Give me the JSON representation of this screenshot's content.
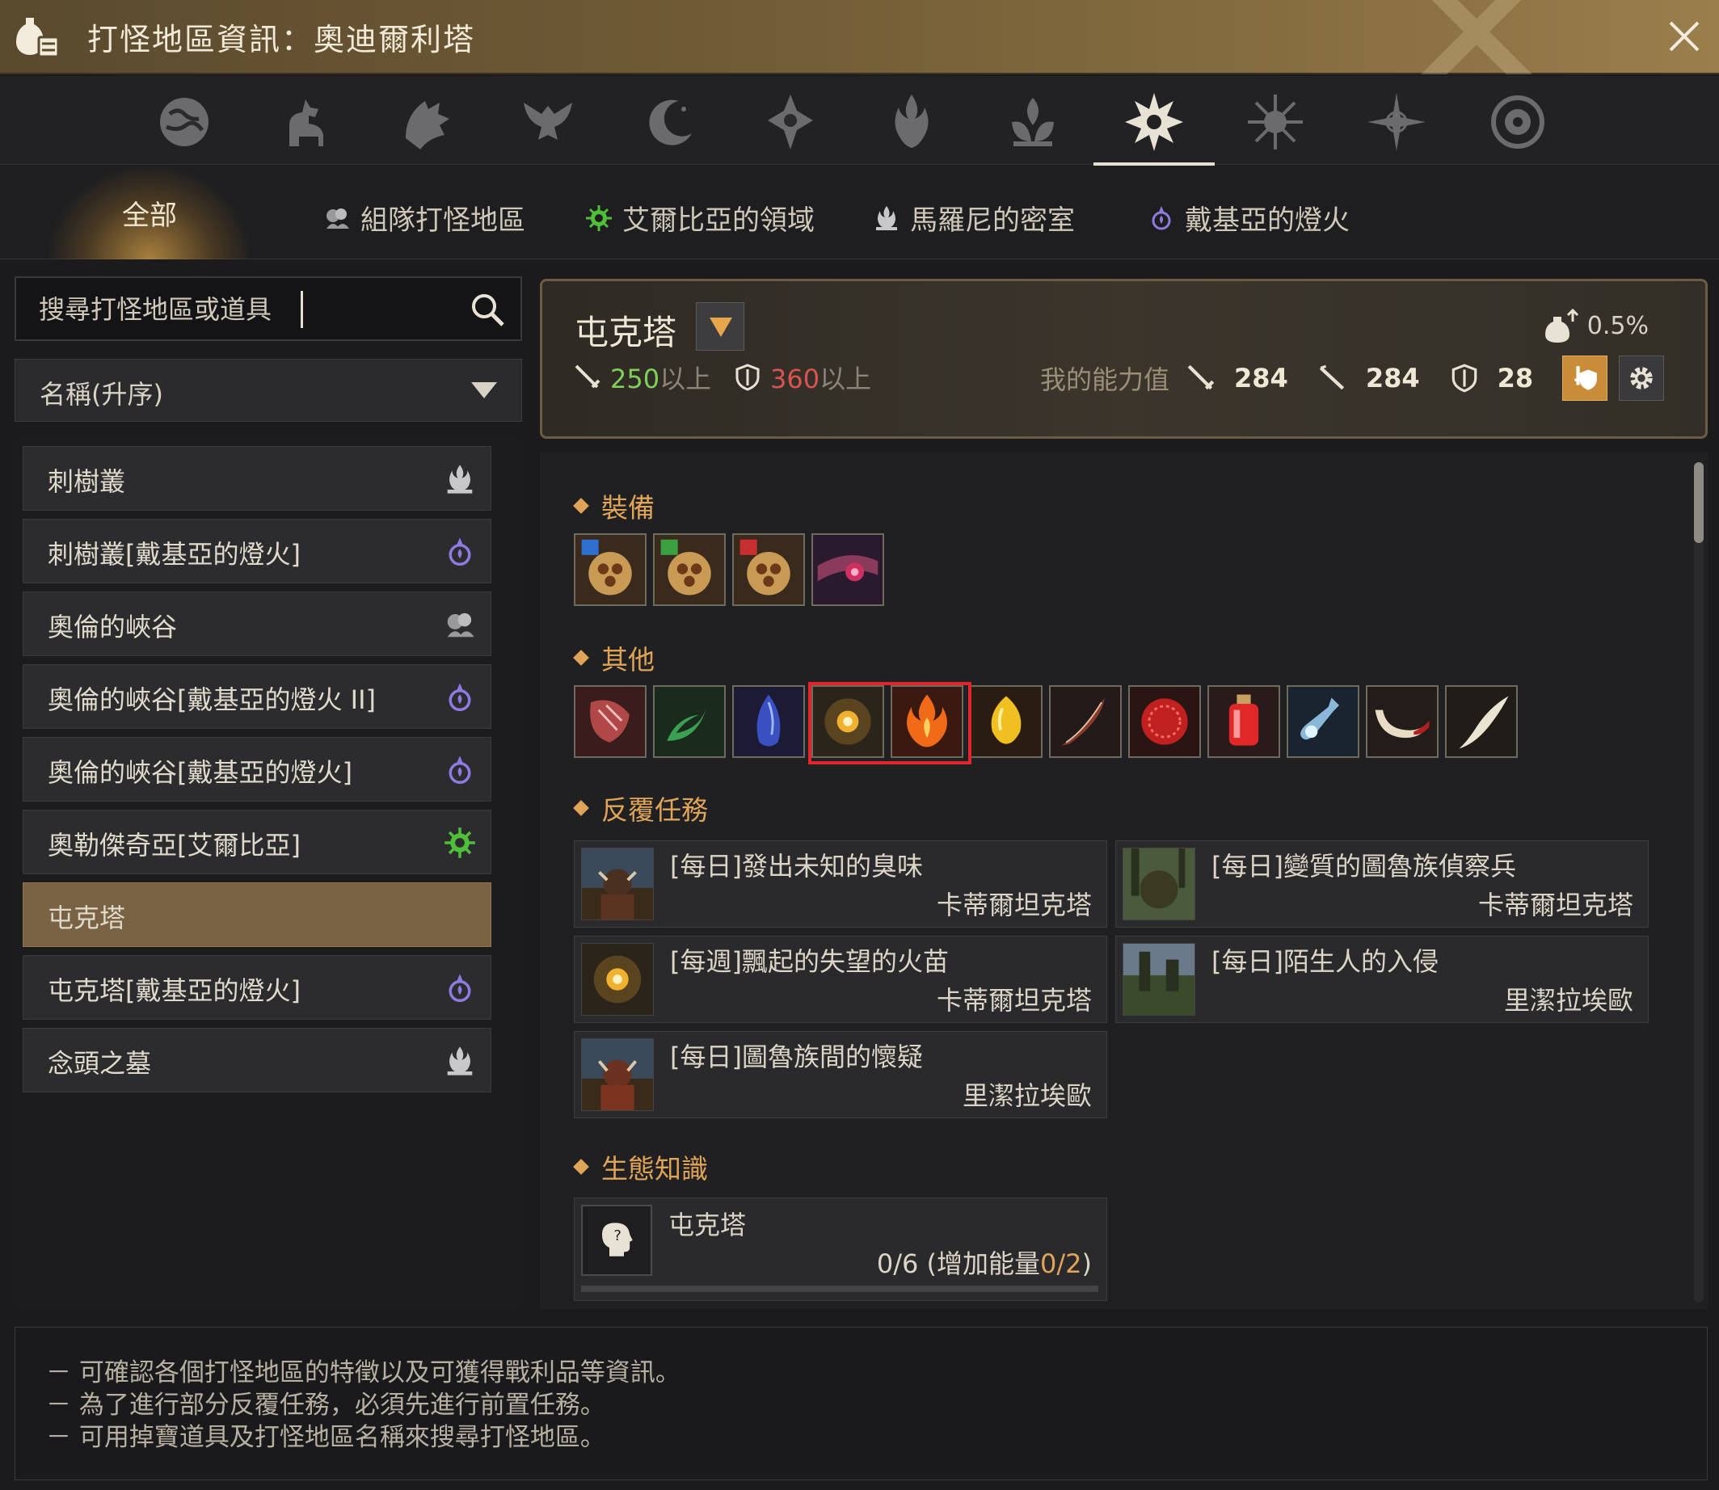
{
  "window": {
    "title": "打怪地區資訊：奧迪爾利塔",
    "icons": {
      "logo": "potion-bag-icon",
      "close": "close-icon"
    }
  },
  "category_icons": [
    "world-icon",
    "horse-icon",
    "wolf-icon",
    "eagle-icon",
    "moon-icon",
    "compass-icon",
    "flame-crest-icon",
    "lotus-icon",
    "odyllita-star-icon",
    "sun-icon",
    "star-compass-icon",
    "dial-icon"
  ],
  "active_category": 8,
  "tabs": {
    "all": "全部",
    "party": "組隊打怪地區",
    "elvia": "艾爾比亞的領域",
    "marni": "馬羅尼的密室",
    "dehkia": "戴基亞的燈火"
  },
  "search": {
    "placeholder": "搜尋打怪地區或道具"
  },
  "sort": {
    "label": "名稱(升序)"
  },
  "zones": [
    {
      "name": "刺樹叢",
      "icon": "marni-icon"
    },
    {
      "name": "刺樹叢[戴基亞的燈火]",
      "icon": "dehkia-icon"
    },
    {
      "name": "奧倫的峽谷",
      "icon": "party-icon"
    },
    {
      "name": "奧倫的峽谷[戴基亞的燈火 II]",
      "icon": "dehkia-icon"
    },
    {
      "name": "奧倫的峽谷[戴基亞的燈火]",
      "icon": "dehkia-icon"
    },
    {
      "name": "奧勒傑奇亞[艾爾比亞]",
      "icon": "elvia-icon"
    },
    {
      "name": "屯克塔",
      "icon": "",
      "selected": true
    },
    {
      "name": "屯克塔[戴基亞的燈火]",
      "icon": "dehkia-icon"
    },
    {
      "name": "念頭之墓",
      "icon": "marni-icon"
    }
  ],
  "detail": {
    "zone_name": "屯克塔",
    "ap_req": "250",
    "ap_suffix": "以上",
    "dp_req": "360",
    "dp_suffix": "以上",
    "my_stats_label": "我的能力值",
    "ap": "284",
    "awaken_ap": "284",
    "dp": "28",
    "drop_rate": "0.5%",
    "sections": {
      "equipment": "裝備",
      "others": "其他",
      "repeat_quests": "反覆任務",
      "knowledge": "生態知識"
    },
    "equipment_items": [
      "tungrad-ring-blue-icon",
      "tungrad-ring-green-icon",
      "tungrad-ring-red-icon",
      "belt-icon"
    ],
    "other_items": [
      "red-hide-icon",
      "green-horn-icon",
      "blue-crystal-icon",
      "flame-orb-icon",
      "fire-essence-icon",
      "gold-stone-icon",
      "blade-shard-icon",
      "red-orb-icon",
      "red-potion-icon",
      "elixir-icon",
      "white-horn-icon",
      "tusk-icon"
    ],
    "highlighted_items": [
      3,
      4
    ],
    "quests": [
      {
        "title": "[每日]發出未知的臭味",
        "npc": "卡蒂爾坦克塔"
      },
      {
        "title": "[每日]變質的圖魯族偵察兵",
        "npc": "卡蒂爾坦克塔"
      },
      {
        "title": "[每週]飄起的失望的火苗",
        "npc": "卡蒂爾坦克塔"
      },
      {
        "title": "[每日]陌生人的入侵",
        "npc": "里潔拉埃歐"
      },
      {
        "title": "[每日]圖魯族間的懷疑",
        "npc": "里潔拉埃歐"
      }
    ],
    "knowledge": {
      "name": "屯克塔",
      "progress": "0/6",
      "energy_open": " (增加能量",
      "energy_value": "0/2",
      "energy_close": ")"
    }
  },
  "footer_notes": [
    "－ 可確認各個打怪地區的特徵以及可獲得戰利品等資訊。",
    "－ 為了進行部分反覆任務，必須先進行前置任務。",
    "－ 可用掉寶道具及打怪地區名稱來搜尋打怪地區。"
  ]
}
